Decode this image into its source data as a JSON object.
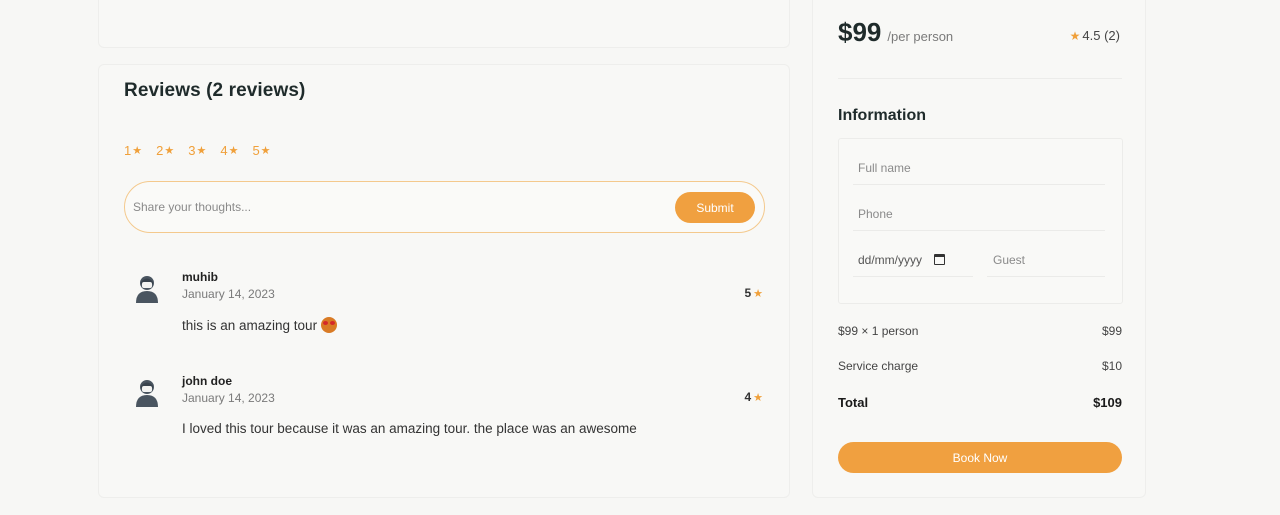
{
  "reviews": {
    "title": "Reviews (2 reviews)",
    "filters": [
      "1",
      "2",
      "3",
      "4",
      "5"
    ],
    "input_placeholder": "Share your thoughts...",
    "submit_label": "Submit",
    "items": [
      {
        "name": "muhib",
        "date": "January 14, 2023",
        "rating": "5",
        "text": "this is an amazing tour"
      },
      {
        "name": "john doe",
        "date": "January 14, 2023",
        "rating": "4",
        "text": "I loved this tour because it was an amazing tour. the place was an awesome"
      }
    ]
  },
  "booking": {
    "price": "$99",
    "per_person": "/per person",
    "overall_rating": "4.5 (2)",
    "info_title": "Information",
    "fullname_placeholder": "Full name",
    "phone_placeholder": "Phone",
    "date_placeholder": "dd/mm/yyyy",
    "guest_placeholder": "Guest",
    "summary": [
      {
        "label": "$99 × 1 person",
        "amount": "$99"
      },
      {
        "label": "Service charge",
        "amount": "$10"
      },
      {
        "label": "Total",
        "amount": "$109"
      }
    ],
    "book_label": "Book Now"
  },
  "colors": {
    "accent": "#f0a040",
    "star": "#f0a03a",
    "background": "#f7f7f5"
  },
  "icons": {
    "star": "star-icon",
    "avatar": "user-avatar-icon",
    "calendar": "calendar-icon",
    "emoji": "star-struck-emoji-icon"
  }
}
